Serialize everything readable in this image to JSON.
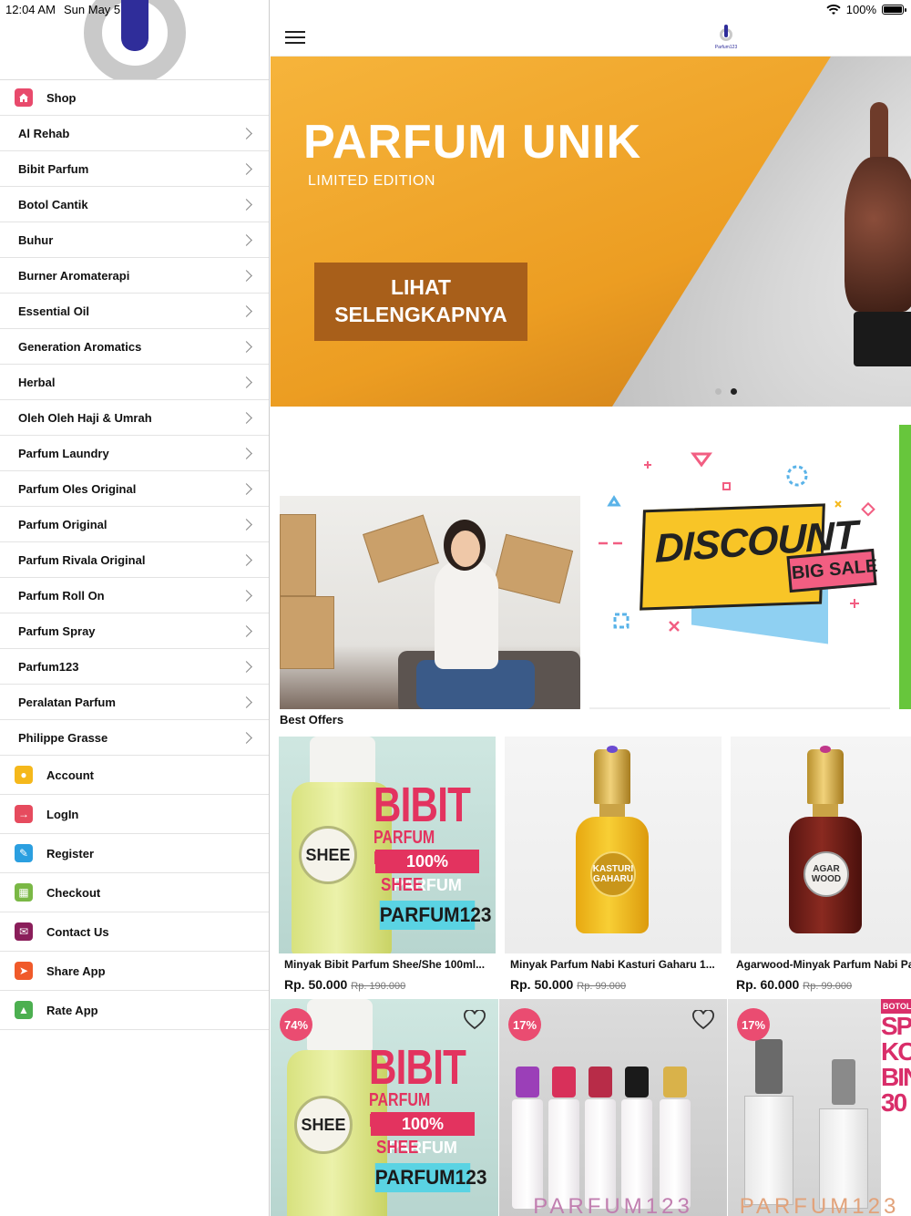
{
  "status": {
    "time": "12:04 AM",
    "date": "Sun May 5",
    "battery": "100%"
  },
  "drawer": {
    "shop_label": "Shop",
    "categories": [
      "Al Rehab",
      "Bibit Parfum",
      "Botol Cantik",
      "Buhur",
      "Burner Aromaterapi",
      "Essential Oil",
      "Generation Aromatics",
      "Herbal",
      "Oleh Oleh Haji & Umrah",
      "Parfum Laundry",
      "Parfum Oles Original",
      "Parfum Original",
      "Parfum Rivala Original",
      "Parfum Roll On",
      "Parfum Spray",
      "Parfum123",
      "Peralatan Parfum",
      "Philippe Grasse"
    ],
    "menu": [
      {
        "label": "Account",
        "icon": "account-icon",
        "color": "#f5b81b"
      },
      {
        "label": "LogIn",
        "icon": "login-icon",
        "color": "#e64b5e"
      },
      {
        "label": "Register",
        "icon": "register-icon",
        "color": "#2b9fe0"
      },
      {
        "label": "Checkout",
        "icon": "cart-icon",
        "color": "#7ab845"
      },
      {
        "label": "Contact Us",
        "icon": "mail-icon",
        "color": "#8a1e5a"
      },
      {
        "label": "Share App",
        "icon": "share-icon",
        "color": "#f05a2a"
      },
      {
        "label": "Rate App",
        "icon": "thumbs-up-icon",
        "color": "#4caf50"
      }
    ]
  },
  "header": {
    "logo_text": "Parfum123"
  },
  "hero": {
    "title": "PARFUM UNIK",
    "subtitle": "LIMITED EDITION",
    "button_line1": "LIHAT",
    "button_line2": "SELENGKAPNYA",
    "slides": 2,
    "active_slide": 2
  },
  "promo": {
    "discount": "DISCOUNT",
    "big_sale": "BIG SALE"
  },
  "section_title": "Best Offers",
  "products_row1": [
    {
      "name": "Minyak Bibit Parfum Shee/She 100ml...",
      "price": "Rp. 50.000",
      "old_price": "Rp. 190.000"
    },
    {
      "name": "Minyak Parfum Nabi Kasturi Gaharu 1...",
      "price": "Rp. 50.000",
      "old_price": "Rp. 99.000"
    },
    {
      "name": "Agarwood-Minyak Parfum Nabi Pa",
      "price": "Rp. 60.000",
      "old_price": "Rp. 99.000"
    }
  ],
  "bibit_art": {
    "label": "SHEE",
    "line1": "BIBIT",
    "line2": "PARFUM MURNI",
    "line3": "100% PARFUM",
    "line4": "SHEE",
    "line5": "PARFUM123"
  },
  "attar_labels": {
    "kasturi": "KASTURI GAHARU",
    "agarwood": "AGAR WOOD",
    "brand": "PARFUM123"
  },
  "products_row2": [
    {
      "badge": "74%"
    },
    {
      "badge": "17%"
    },
    {
      "badge": "17%"
    }
  ],
  "row2_art": {
    "brand": "PARFUM123",
    "botol": "BOTOL",
    "big": "SP\nKO\nBIN\n30"
  }
}
